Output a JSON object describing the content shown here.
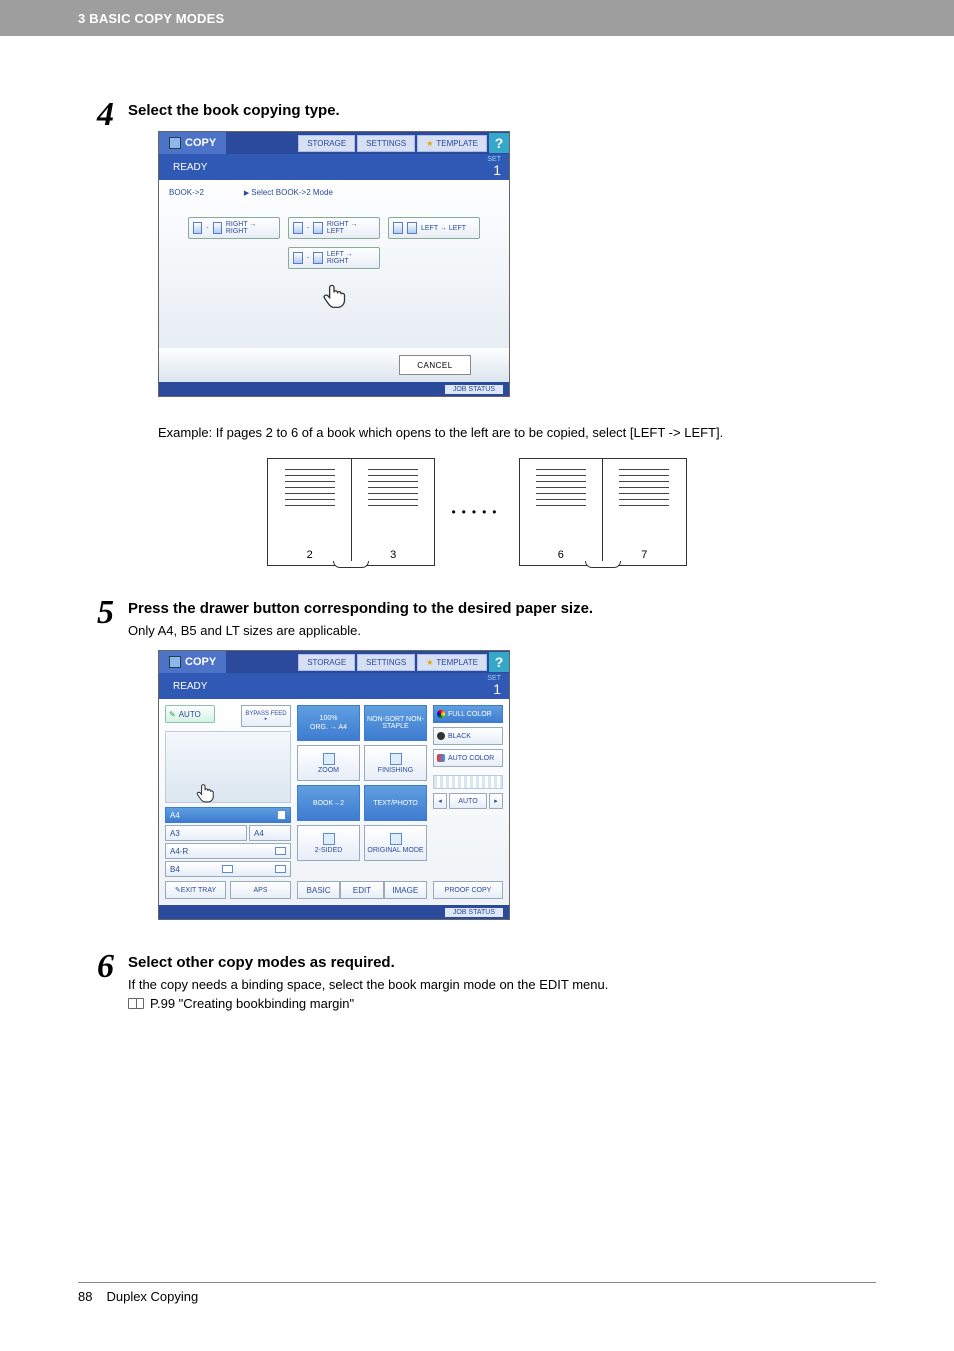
{
  "header": {
    "section": "3 BASIC COPY MODES"
  },
  "steps": {
    "s4": {
      "num": "4",
      "title": "Select the book copying type."
    },
    "s5": {
      "num": "5",
      "title": "Press the drawer button corresponding to the desired paper size.",
      "sub": "Only A4, B5 and LT sizes are applicable."
    },
    "s6": {
      "num": "6",
      "title": "Select other copy modes as required.",
      "sub": "If the copy needs a binding space, select the book margin mode on the EDIT menu.",
      "ref": "P.99 \"Creating bookbinding margin\""
    }
  },
  "example": "Example: If pages 2 to 6 of a book which opens to the left are to be copied, select [LEFT -> LEFT].",
  "spread": {
    "p1": "2",
    "p2": "3",
    "p3": "6",
    "p4": "7"
  },
  "scr1": {
    "copy": "COPY",
    "storage": "STORAGE",
    "settings": "SETTINGS",
    "template": "TEMPLATE",
    "q": "?",
    "ready": "READY",
    "set": "SET",
    "one": "1",
    "mode": "BOOK->2",
    "prompt": "Select BOOK->2 Mode",
    "rr": "RIGHT → RIGHT",
    "rl": "RIGHT → LEFT",
    "ll": "LEFT → LEFT",
    "lr": "LEFT → RIGHT",
    "cancel": "CANCEL",
    "job": "JOB STATUS"
  },
  "scr2": {
    "copy": "COPY",
    "storage": "STORAGE",
    "settings": "SETTINGS",
    "template": "TEMPLATE",
    "q": "?",
    "ready": "READY",
    "set": "SET",
    "one": "1",
    "auto": "AUTO",
    "bypass": "BYPASS FEED",
    "a4": "A4",
    "a3": "A3",
    "a4_2": "A4",
    "a4r": "A4-R",
    "b4": "B4",
    "exit": "EXIT TRAY",
    "aps": "APS",
    "zoom_pct": "100%",
    "zoom_org": "ORG. → A4",
    "zoom": "ZOOM",
    "book2": "BOOK→2",
    "twosided": "2-SIDED",
    "nonsort": "NON-SORT NON-STAPLE",
    "finishing": "FINISHING",
    "textphoto": "TEXT/PHOTO",
    "origmode": "ORIGINAL MODE",
    "basic": "BASIC",
    "edit": "EDIT",
    "image": "IMAGE",
    "fullcolor": "FULL COLOR",
    "black": "BLACK",
    "autocolor": "AUTO COLOR",
    "autob": "AUTO",
    "proof": "PROOF COPY",
    "job": "JOB STATUS"
  },
  "footer": {
    "page": "88",
    "title": "Duplex Copying"
  }
}
